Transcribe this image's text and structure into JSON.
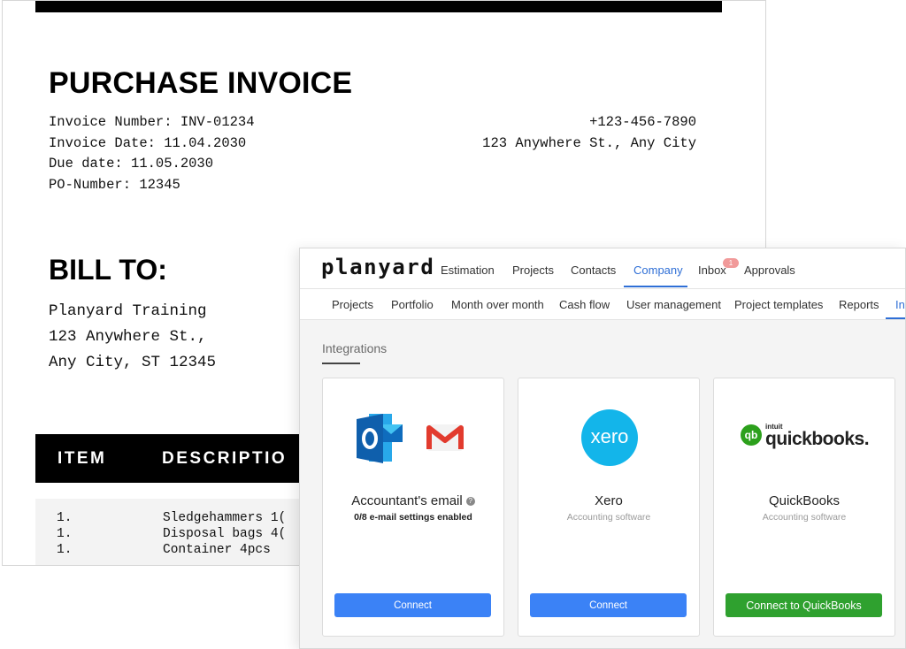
{
  "invoice": {
    "title": "PURCHASE INVOICE",
    "meta": [
      "Invoice Number: INV-01234",
      "Invoice Date: 11.04.2030",
      "Due date: 11.05.2030",
      "PO-Number: 12345"
    ],
    "contact": [
      "+123-456-7890",
      "123 Anywhere St., Any City"
    ],
    "bill_to_title": "BILL TO:",
    "bill_to": [
      "Planyard Training",
      "123 Anywhere St.,",
      "Any City, ST 12345"
    ],
    "table": {
      "headers": [
        "ITEM",
        "DESCRIPTIO"
      ],
      "rows": [
        {
          "num": "1.",
          "desc": "Sledgehammers 1("
        },
        {
          "num": "1.",
          "desc": "Disposal bags 4("
        },
        {
          "num": "1.",
          "desc": "Container 4pcs"
        }
      ]
    }
  },
  "app": {
    "logo": "planyard",
    "nav": [
      "Estimation",
      "Projects",
      "Contacts",
      "Company",
      "Inbox",
      "Approvals"
    ],
    "inbox_badge": "1",
    "subnav": [
      "Projects",
      "Portfolio",
      "Month over month",
      "Cash flow",
      "User management",
      "Project templates",
      "Reports",
      "In"
    ],
    "section_title": "Integrations",
    "cards": [
      {
        "name": "Accountant's email",
        "help": "?",
        "subtitle": "0/8 e-mail settings enabled",
        "button": "Connect"
      },
      {
        "name": "Xero",
        "logo_text": "xero",
        "subtitle": "Accounting software",
        "button": "Connect"
      },
      {
        "name": "QuickBooks",
        "logo_brand": "intuit",
        "logo_text": "quickbooks.",
        "subtitle": "Accounting software",
        "button": "Connect to QuickBooks"
      }
    ],
    "colors": {
      "accent": "#2f6fd6",
      "connect": "#3b82f6",
      "quickbooks": "#2fa12f",
      "xero": "#13b5ea",
      "outlook": "#0f6cbd"
    }
  }
}
